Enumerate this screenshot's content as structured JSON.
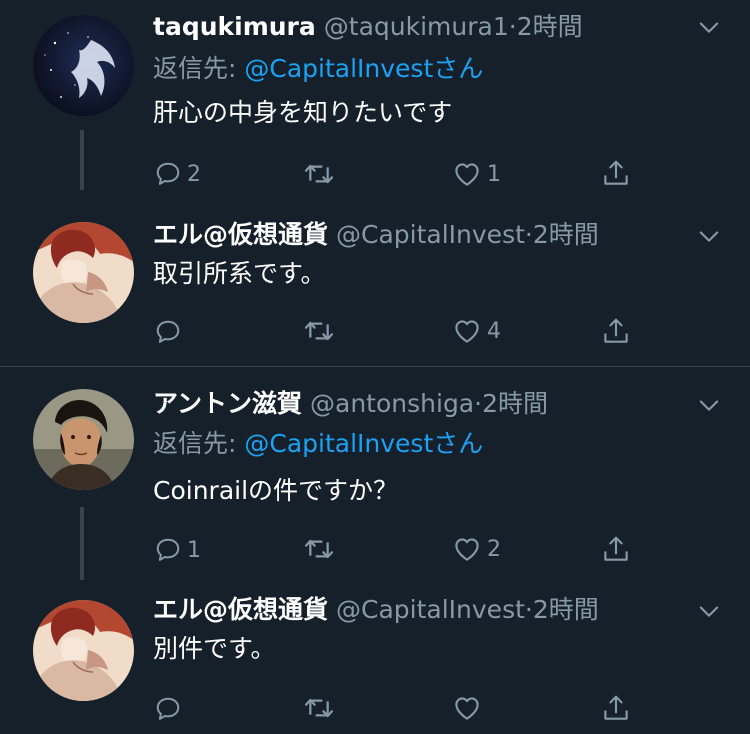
{
  "tweets": [
    {
      "display_name": "taqukimura",
      "handle": "@taqukimura1",
      "separator": "·",
      "time": "2時間",
      "reply_prefix": "返信先: ",
      "reply_mention": "@CapitalInvest",
      "reply_suffix": "さん",
      "text": "肝心の中身を知りたいです",
      "reply_count": "2",
      "retweet_count": "",
      "like_count": "1"
    },
    {
      "display_name": "エル@仮想通貨",
      "handle": "@CapitalInvest",
      "separator": "·",
      "time": "2時間",
      "text": "取引所系です。",
      "reply_count": "",
      "retweet_count": "",
      "like_count": "4"
    },
    {
      "display_name": "アントン滋賀",
      "handle": "@antonshiga",
      "separator": "·",
      "time": "2時間",
      "reply_prefix": "返信先: ",
      "reply_mention": "@CapitalInvest",
      "reply_suffix": "さん",
      "text": "Coinrailの件ですか？",
      "reply_count": "1",
      "retweet_count": "",
      "like_count": "2"
    },
    {
      "display_name": "エル@仮想通貨",
      "handle": "@CapitalInvest",
      "separator": "·",
      "time": "2時間",
      "text": "別件です。",
      "reply_count": "",
      "retweet_count": "",
      "like_count": ""
    }
  ],
  "colors": {
    "background": "#15202b",
    "text_primary": "#ffffff",
    "text_secondary": "#8899a6",
    "accent": "#1da1f2",
    "divider": "#38444d"
  },
  "icons": {
    "reply": "speech-bubble-icon",
    "retweet": "retweet-icon",
    "like": "heart-icon",
    "share": "share-icon",
    "caret": "chevron-down-icon"
  }
}
